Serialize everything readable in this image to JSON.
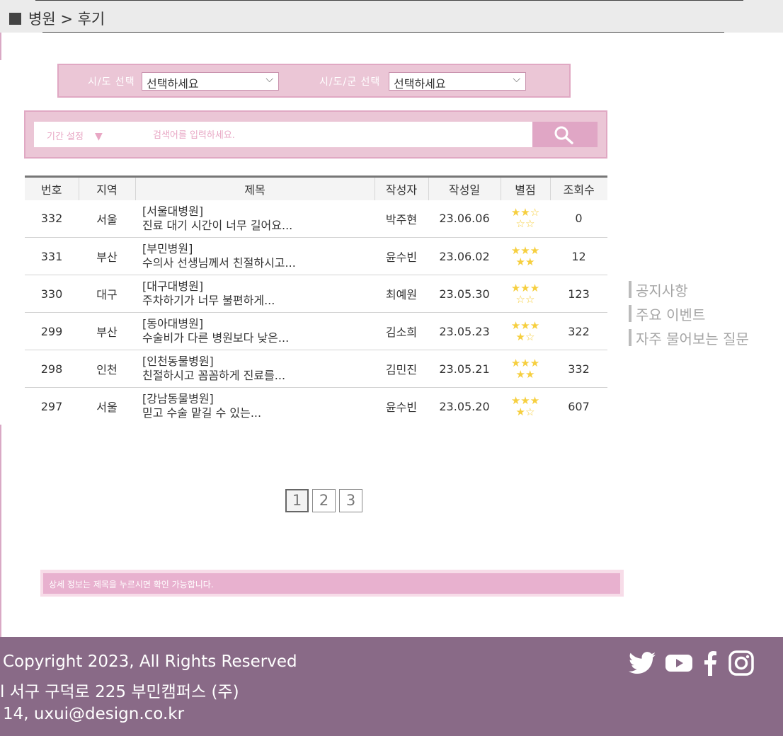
{
  "breadcrumb": {
    "text": "병원 > 후기"
  },
  "filters": {
    "sido_label": "시/도 선택",
    "sido_value": "선택하세요",
    "sigungu_label": "시/도/군 선택",
    "sigungu_value": "선택하세요"
  },
  "search": {
    "period_label": "기간 설정",
    "period_icon": "triangle-down-icon",
    "placeholder": "검색어를 입력하세요.",
    "button_icon": "search-icon"
  },
  "table": {
    "headers": [
      "번호",
      "지역",
      "제목",
      "작성자",
      "작성일",
      "별점",
      "조회수"
    ],
    "rows": [
      {
        "no": "332",
        "region": "서울",
        "hospital": "[서울대병원]",
        "title": "진료 대기 시간이 너무 길어요...",
        "author": "박주현",
        "date": "23.06.06",
        "rating": 2,
        "rating_stars": "★★☆\n☆☆",
        "views": "0"
      },
      {
        "no": "331",
        "region": "부산",
        "hospital": "[부민병원]",
        "title": "수의사 선생님께서 친절하시고...",
        "author": "윤수빈",
        "date": "23.06.02",
        "rating": 5,
        "rating_stars": "★★★\n★★",
        "views": "12"
      },
      {
        "no": "330",
        "region": "대구",
        "hospital": "[대구대병원]",
        "title": "주차하기가 너무 불편하게...",
        "author": "최예원",
        "date": "23.05.30",
        "rating": 3,
        "rating_stars": "★★★\n☆☆",
        "views": "123"
      },
      {
        "no": "299",
        "region": "부산",
        "hospital": "[동아대병원]",
        "title": "수술비가 다른 병원보다 낮은...",
        "author": "김소희",
        "date": "23.05.23",
        "rating": 4,
        "rating_stars": "★★★\n★☆",
        "views": "322"
      },
      {
        "no": "298",
        "region": "인천",
        "hospital": "[인천동물병원]",
        "title": "친절하시고 꼼꼼하게 진료를...",
        "author": "김민진",
        "date": "23.05.21",
        "rating": 5,
        "rating_stars": "★★★\n★★",
        "views": "332"
      },
      {
        "no": "297",
        "region": "서울",
        "hospital": "[강남동물병원]",
        "title": "믿고 수술 맡길 수 있는...",
        "author": "윤수빈",
        "date": "23.05.20",
        "rating": 4,
        "rating_stars": "★★★\n★☆",
        "views": "607"
      }
    ]
  },
  "side_menu": {
    "items": [
      "공지사항",
      "주요 이벤트",
      "자주 물어보는 질문"
    ]
  },
  "pagination": {
    "pages": [
      "1",
      "2",
      "3"
    ],
    "current": "1"
  },
  "notice": {
    "text": "상세 정보는 제목을 누르시면 확인 가능합니다."
  },
  "footer": {
    "copyright": "Copyright 2023, All Rights Reserved",
    "address": "l 서구 구덕로 225 부민캠퍼스 (주)",
    "contact": "14, uxui@design.co.kr",
    "social_icons": [
      "twitter-icon",
      "youtube-icon",
      "facebook-icon",
      "instagram-icon"
    ]
  },
  "colors": {
    "pink_panel": "#ebc6d6",
    "pink_border": "#e0a8c3",
    "search_button": "#e0a6c5",
    "star": "#f6cf3f",
    "footer_bg": "#896a87"
  }
}
